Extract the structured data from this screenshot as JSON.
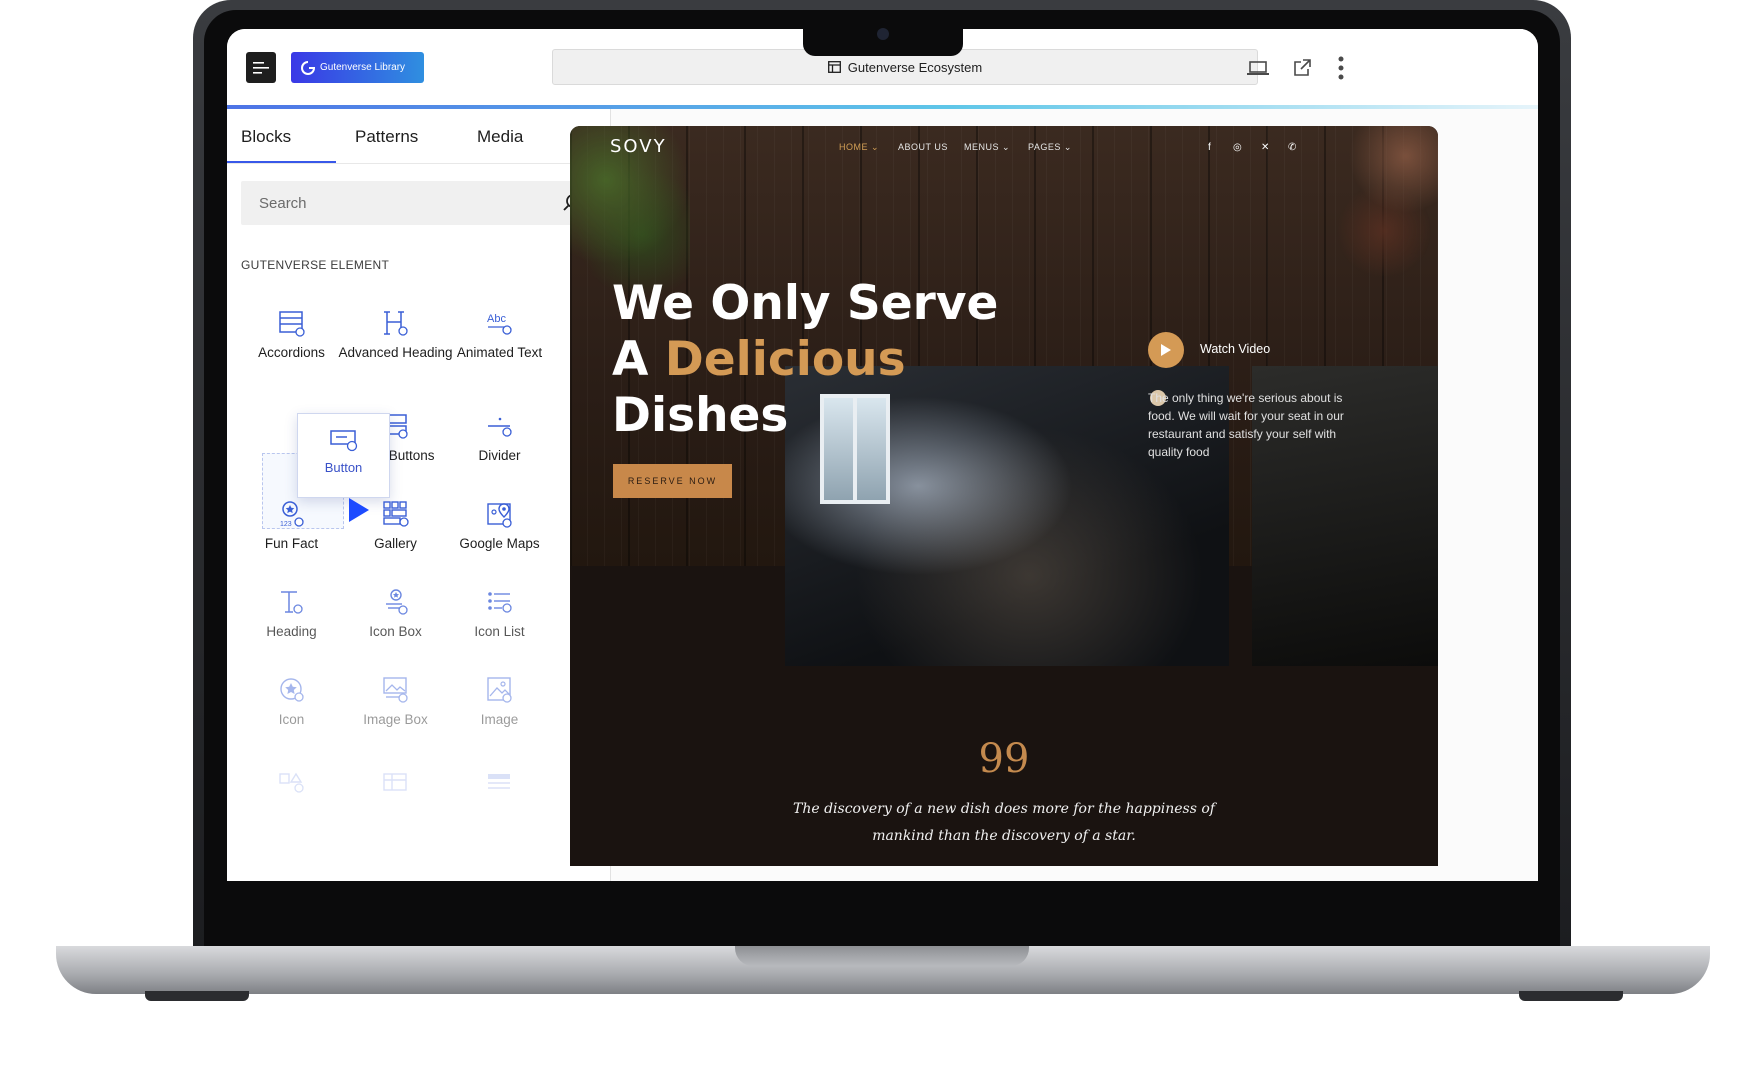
{
  "topbar": {
    "library_label": "Gutenverse Library",
    "document_title": "Gutenverse Ecosystem"
  },
  "sidebar": {
    "tabs": [
      {
        "label": "Blocks",
        "active": true
      },
      {
        "label": "Patterns",
        "active": false
      },
      {
        "label": "Media",
        "active": false
      }
    ],
    "search_placeholder": "Search",
    "section_title": "GUTENVERSE ELEMENT",
    "blocks": [
      {
        "label": "Accordions",
        "icon": "accordion-icon"
      },
      {
        "label": "Advanced Heading",
        "icon": "advanced-heading-icon"
      },
      {
        "label": "Animated Text",
        "icon": "animated-text-icon"
      },
      {
        "label": "Multi Buttons",
        "icon": "multi-buttons-icon"
      },
      {
        "label": "Divider",
        "icon": "divider-icon"
      },
      {
        "label": "Fun Fact",
        "icon": "fun-fact-icon"
      },
      {
        "label": "Gallery",
        "icon": "gallery-icon"
      },
      {
        "label": "Google Maps",
        "icon": "google-maps-icon"
      },
      {
        "label": "Heading",
        "icon": "heading-icon"
      },
      {
        "label": "Icon Box",
        "icon": "icon-box-icon"
      },
      {
        "label": "Icon List",
        "icon": "icon-list-icon"
      },
      {
        "label": "Icon",
        "icon": "icon-icon"
      },
      {
        "label": "Image Box",
        "icon": "image-box-icon"
      },
      {
        "label": "Image",
        "icon": "image-icon"
      }
    ],
    "dragging_block": {
      "label": "Button",
      "icon": "button-icon"
    }
  },
  "preview": {
    "logo": "SOVY",
    "nav": [
      "HOME",
      "ABOUT US",
      "MENUS",
      "PAGES"
    ],
    "hero_title_line1": "We Only Serve",
    "hero_title_a": "A",
    "hero_title_accent": "Delicious",
    "hero_title_line3": "Dishes",
    "reserve_label": "RESERVE NOW",
    "watch_video": "Watch Video",
    "hero_description": "The only thing we're serious about is food. We will wait for your seat in our restaurant and satisfy your self with quality food",
    "quote_mark": "99",
    "quote_text": "The discovery of a new dish does more for the happiness of mankind than the discovery of a star.",
    "colors": {
      "accent": "#d49a55",
      "button": "#c8884a",
      "brand_blue": "#3858e9"
    }
  }
}
